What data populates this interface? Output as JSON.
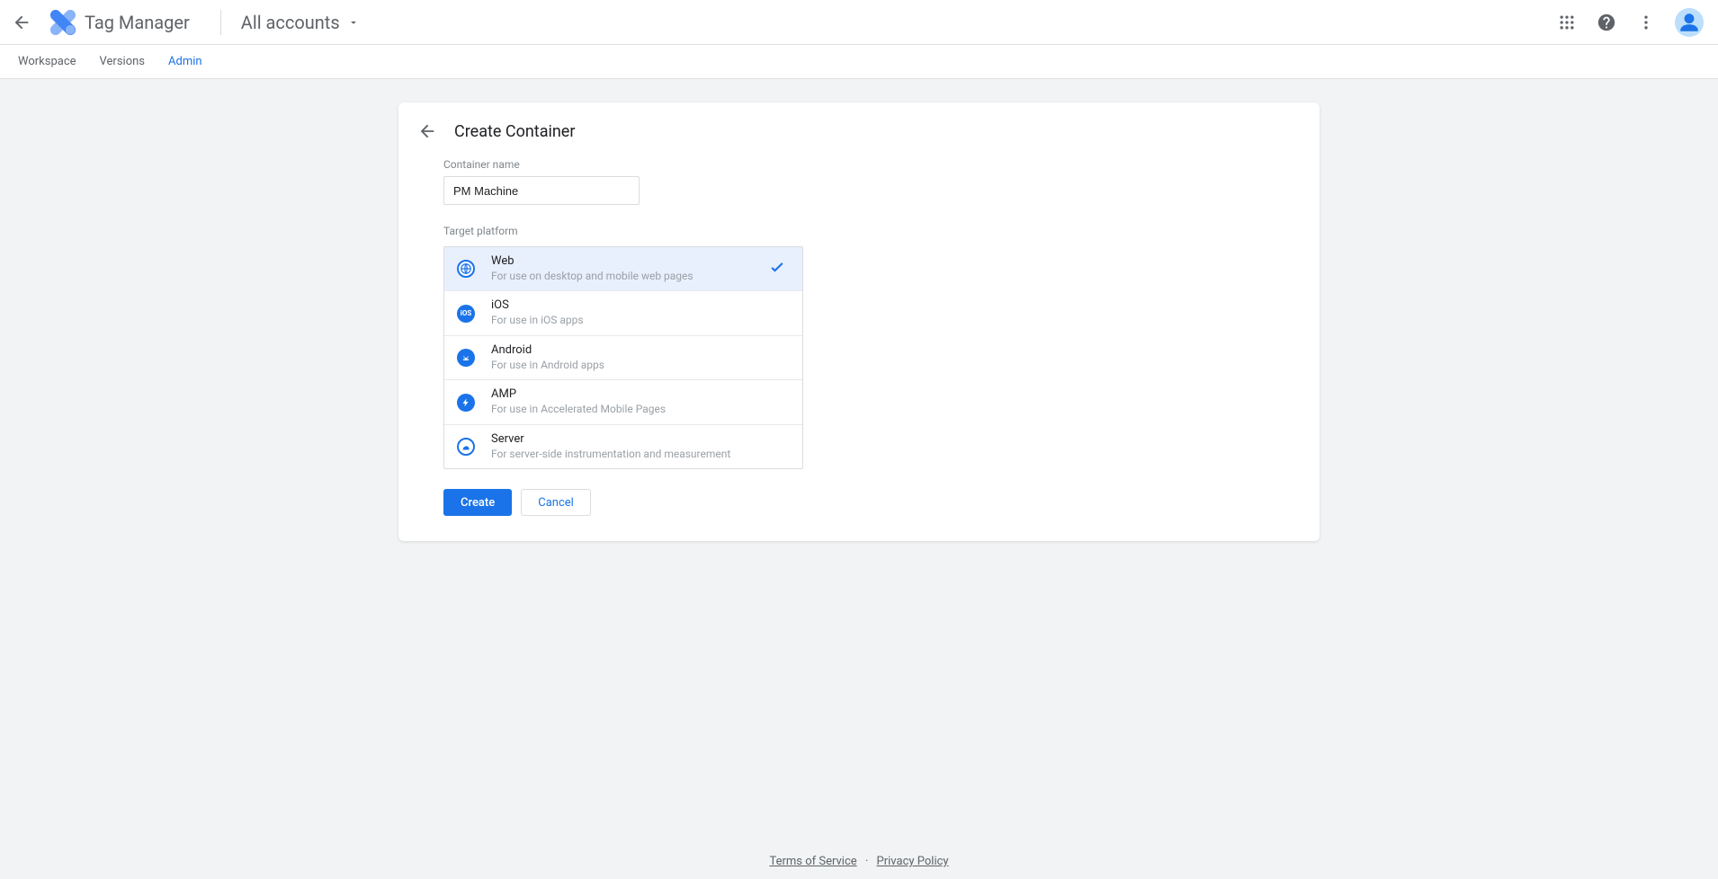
{
  "header": {
    "app_name": "Tag Manager",
    "accounts_label": "All accounts"
  },
  "tabs": {
    "workspace": "Workspace",
    "versions": "Versions",
    "admin": "Admin"
  },
  "card": {
    "title": "Create Container",
    "name_label": "Container name",
    "name_value": "PM Machine",
    "platform_label": "Target platform"
  },
  "platforms": [
    {
      "name": "Web",
      "desc": "For use on desktop and mobile web pages",
      "selected": true
    },
    {
      "name": "iOS",
      "desc": "For use in iOS apps"
    },
    {
      "name": "Android",
      "desc": "For use in Android apps"
    },
    {
      "name": "AMP",
      "desc": "For use in Accelerated Mobile Pages"
    },
    {
      "name": "Server",
      "desc": "For server-side instrumentation and measurement"
    }
  ],
  "actions": {
    "create": "Create",
    "cancel": "Cancel"
  },
  "footer": {
    "tos": "Terms of Service",
    "privacy": "Privacy Policy"
  }
}
